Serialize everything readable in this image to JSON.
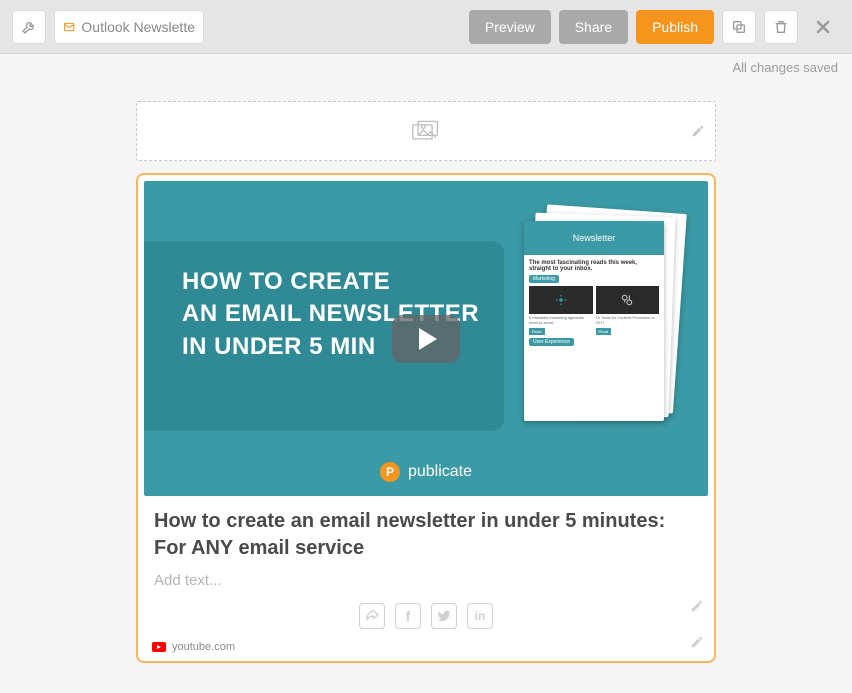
{
  "toolbar": {
    "title": "Outlook Newslette",
    "preview": "Preview",
    "share": "Share",
    "publish": "Publish"
  },
  "status": "All changes saved",
  "thumbnail": {
    "headline_l1": "HOW TO CREATE",
    "headline_l2": "AN EMAIL NEWSLETTER",
    "headline_l3": "IN UNDER 5 MIN",
    "brand": "publicate",
    "mock": {
      "header": "Newsletter",
      "sub": "The most fascinating reads this week, straight to your inbox.",
      "tag1": "Marketing",
      "card1_title": "5 mistakes marketing agencies need to avoid",
      "card2_title": "10 Tools for Content Promotion in 2017",
      "read": "Read",
      "tag2": "User Experience"
    }
  },
  "card": {
    "title": "How to create an email newsletter in under 5 minutes: For ANY email service",
    "placeholder": "Add text...",
    "source": "youtube.com"
  }
}
